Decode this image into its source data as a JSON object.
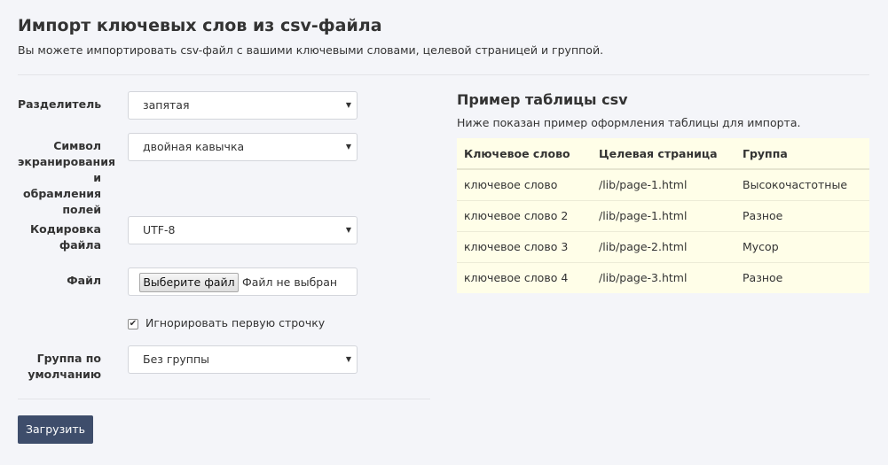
{
  "header": {
    "title": "Импорт ключевых слов из csv-файла",
    "subtitle": "Вы можете импортировать csv-файл с вашими ключевыми словами, целевой страницей и группой."
  },
  "form": {
    "separator": {
      "label": "Разделитель",
      "value": "запятая"
    },
    "escape": {
      "label_lines": [
        "Символ",
        "экранирования",
        "и обрамления",
        "полей"
      ],
      "value": "двойная кавычка"
    },
    "encoding": {
      "label_lines": [
        "Кодировка",
        "файла"
      ],
      "value": "UTF-8"
    },
    "file": {
      "label": "Файл",
      "button_label": "Выберите файл",
      "status": "Файл не выбран"
    },
    "ignore_first_row": {
      "label": "Игнорировать первую строчку",
      "checked": true,
      "check_glyph": "✔"
    },
    "default_group": {
      "label_lines": [
        "Группа по",
        "умолчанию"
      ],
      "value": "Без группы"
    },
    "select_arrow": "▼",
    "submit_label": "Загрузить"
  },
  "example": {
    "title": "Пример таблицы csv",
    "subtitle": "Ниже показан пример оформления таблицы для импорта.",
    "columns": [
      "Ключевое слово",
      "Целевая страница",
      "Группа"
    ],
    "rows": [
      [
        "ключевое слово",
        "/lib/page-1.html",
        "Высокочастотные"
      ],
      [
        "ключевое слово 2",
        "/lib/page-1.html",
        "Разное"
      ],
      [
        "ключевое слово 3",
        "/lib/page-2.html",
        "Мусор"
      ],
      [
        "ключевое слово 4",
        "/lib/page-3.html",
        "Разное"
      ]
    ]
  },
  "colors": {
    "background": "#f4f5f9",
    "submit_button": "#3e4d6b",
    "table_background": "#fffee8"
  }
}
